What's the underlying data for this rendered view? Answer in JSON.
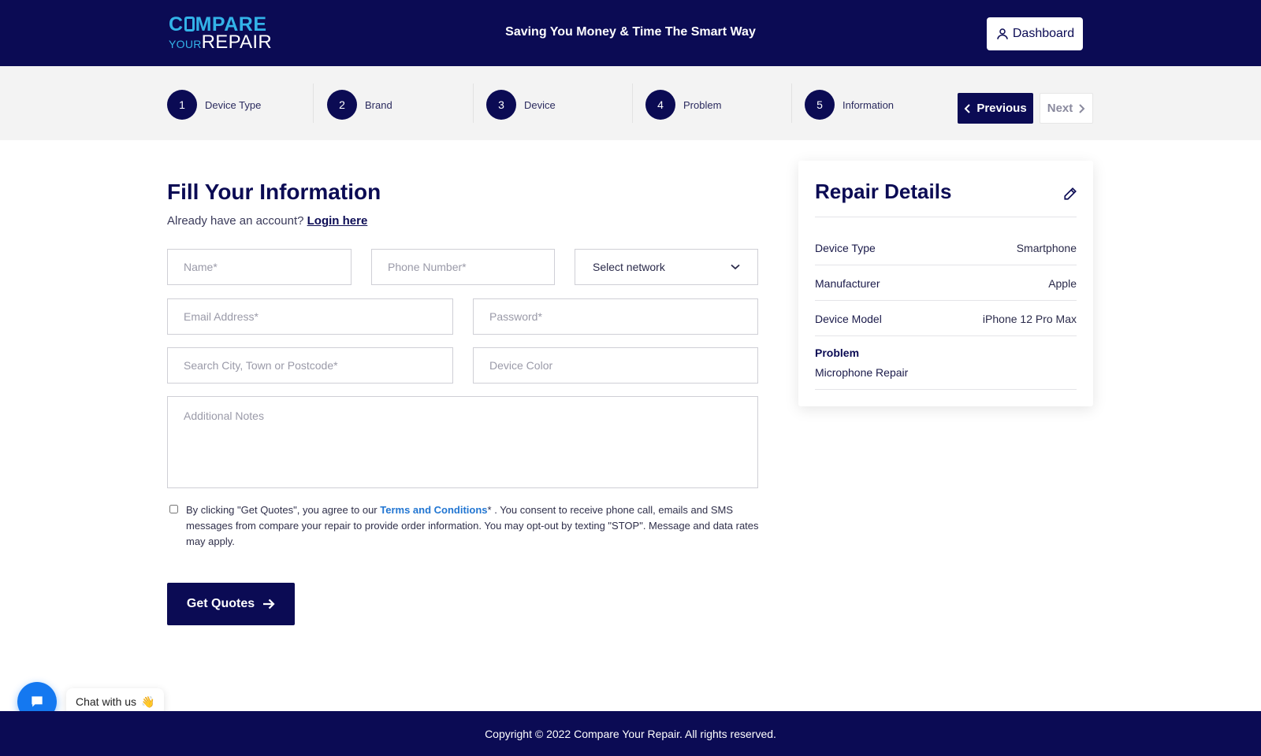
{
  "header": {
    "logo": {
      "line1_a": "C",
      "line1_b": "MPARE",
      "line2_a": "YOUR",
      "line2_b": "REPAIR"
    },
    "tagline": "Saving You Money & Time The Smart Way",
    "dashboard_label": "Dashboard"
  },
  "steps": [
    {
      "num": "1",
      "label": "Device Type"
    },
    {
      "num": "2",
      "label": "Brand"
    },
    {
      "num": "3",
      "label": "Device"
    },
    {
      "num": "4",
      "label": "Problem"
    },
    {
      "num": "5",
      "label": "Information"
    }
  ],
  "nav": {
    "previous_label": "Previous",
    "next_label": "Next"
  },
  "form": {
    "title": "Fill Your Information",
    "account_prompt": "Already have an account?",
    "login_label": "Login here",
    "name_placeholder": "Name*",
    "phone_placeholder": "Phone Number*",
    "network_selected": "Select network",
    "email_placeholder": "Email Address*",
    "password_placeholder": "Password*",
    "city_placeholder": "Search City, Town or Postcode*",
    "color_placeholder": "Device Color",
    "notes_placeholder": "Additional Notes",
    "agree_prefix": "By clicking \"Get Quotes\", you agree to our",
    "terms_label": "Terms and Conditions",
    "agree_suffix": "* . You consent to receive phone call, emails and SMS messages from compare your repair to provide order information. You may opt-out by texting \"STOP\". Message and data rates may apply.",
    "submit_label": "Get Quotes"
  },
  "repair_details": {
    "title": "Repair Details",
    "rows": [
      {
        "key": "Device Type",
        "value": "Smartphone"
      },
      {
        "key": "Manufacturer",
        "value": "Apple"
      },
      {
        "key": "Device Model",
        "value": "iPhone 12 Pro Max"
      }
    ],
    "problem_label": "Problem",
    "problem_value": "Microphone Repair"
  },
  "chat": {
    "label": "Chat with us",
    "emoji": "👋"
  },
  "footer": {
    "copyright": "Copyright © 2022 Compare Your Repair. All rights reserved."
  },
  "colors": {
    "navy": "#0b0b54",
    "accent_blue": "#33b3e8",
    "link_blue": "#2276d2",
    "chat_blue": "#1478f0"
  }
}
